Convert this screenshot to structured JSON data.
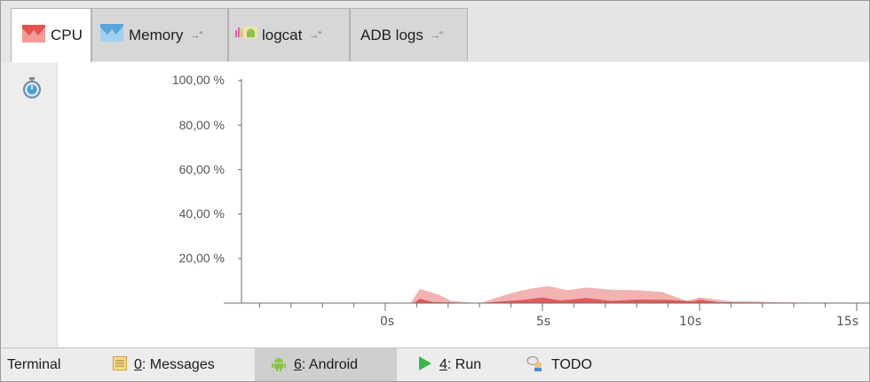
{
  "tabs": [
    {
      "label": "CPU",
      "icon": "cpu-chart-icon",
      "active": true,
      "pin": ""
    },
    {
      "label": "Memory",
      "icon": "memory-chart-icon",
      "active": false,
      "pin": "→\""
    },
    {
      "label": "logcat",
      "icon": "logcat-android-icon",
      "active": false,
      "pin": "→\""
    },
    {
      "label": "ADB logs",
      "icon": "",
      "active": false,
      "pin": "→\""
    }
  ],
  "gutter": {
    "icon": "stopwatch-icon"
  },
  "chart_data": {
    "type": "area",
    "title": "",
    "xlabel": "",
    "ylabel": "",
    "y_ticks": [
      "100,00 %",
      "80,00 %",
      "60,00 %",
      "40,00 %",
      "20,00 %"
    ],
    "x_ticks": [
      "0s",
      "5s",
      "10s",
      "15s"
    ],
    "ylim": [
      0,
      100
    ],
    "xlim": [
      -5,
      15.6
    ],
    "series": [
      {
        "color": "#f2b3b3",
        "x": [
          -5,
          0.8,
          1.1,
          1.7,
          2.1,
          3.0,
          4.0,
          4.6,
          5.2,
          5.8,
          6.4,
          7.2,
          8.0,
          8.8,
          9.6,
          10.0,
          11.0,
          11.6,
          12.5,
          13.5,
          14.5,
          15.6
        ],
        "y": [
          0,
          0,
          6.4,
          3.8,
          1.0,
          0,
          4.5,
          6.5,
          7.6,
          5.8,
          7.0,
          6.0,
          5.8,
          5.0,
          1.0,
          2.6,
          0.8,
          0.8,
          0.4,
          0.3,
          0.3,
          0.2
        ]
      },
      {
        "color": "#e05a5a",
        "x": [
          -5,
          0.9,
          1.1,
          1.5,
          3.0,
          4.4,
          5.0,
          5.6,
          6.4,
          7.2,
          8.0,
          9.0,
          9.8,
          10.0,
          10.6,
          11.5,
          13.0,
          15.6
        ],
        "y": [
          0,
          0,
          2.0,
          0.5,
          0,
          1.5,
          2.5,
          1.2,
          2.3,
          1.0,
          1.6,
          1.5,
          0.8,
          1.6,
          0.4,
          0.3,
          0.2,
          0.1
        ]
      }
    ],
    "colors": {
      "axis": "#6f6f6f",
      "tick_text": "#555555"
    }
  },
  "bottom_bar": [
    {
      "icon": "",
      "prefix": "",
      "underline": "",
      "label": "Terminal",
      "active": false
    },
    {
      "icon": "messages-icon",
      "prefix": "",
      "underline": "0",
      "label": ": Messages",
      "active": false
    },
    {
      "icon": "android-icon",
      "prefix": "",
      "underline": "6",
      "label": ": Android",
      "active": true
    },
    {
      "icon": "run-icon",
      "prefix": "",
      "underline": "4",
      "label": ": Run",
      "active": false
    },
    {
      "icon": "todo-icon",
      "prefix": "",
      "underline": "",
      "label": "TODO",
      "active": false
    }
  ]
}
